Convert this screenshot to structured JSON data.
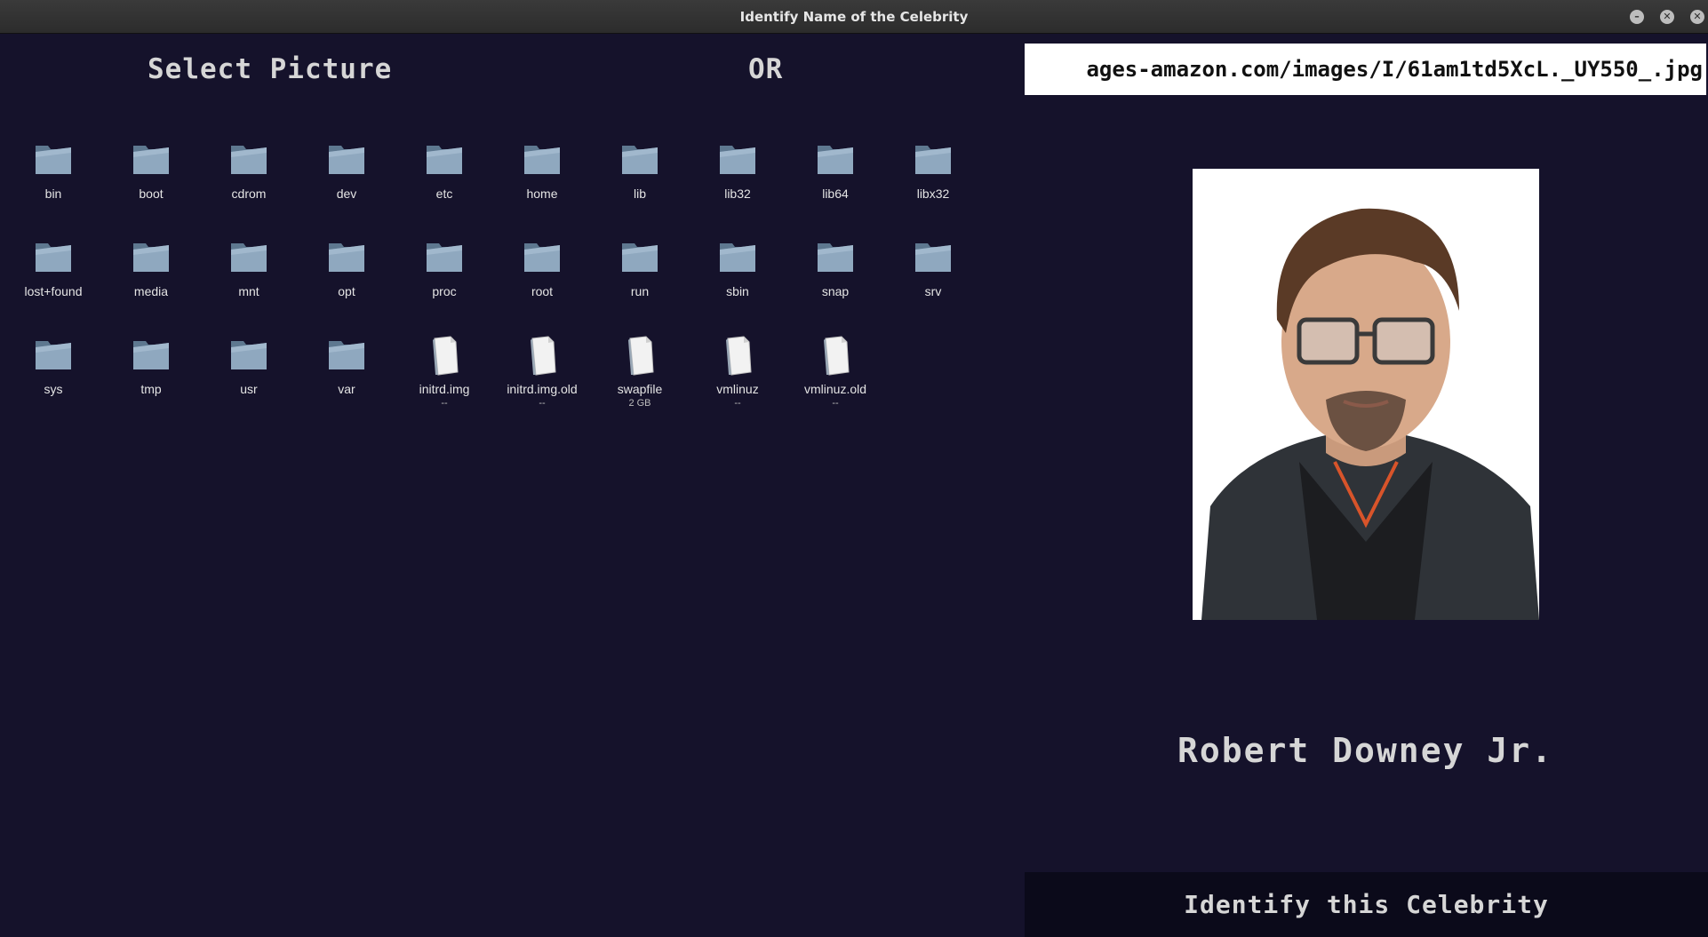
{
  "window": {
    "title": "Identify Name of the Celebrity",
    "buttons": {
      "minimize": "–",
      "maximize": "✕",
      "close": "✕"
    }
  },
  "left_panel": {
    "select_heading": "Select Picture",
    "or_label": "OR",
    "files": [
      {
        "name": "bin",
        "type": "folder"
      },
      {
        "name": "boot",
        "type": "folder"
      },
      {
        "name": "cdrom",
        "type": "folder"
      },
      {
        "name": "dev",
        "type": "folder"
      },
      {
        "name": "etc",
        "type": "folder"
      },
      {
        "name": "home",
        "type": "folder"
      },
      {
        "name": "lib",
        "type": "folder"
      },
      {
        "name": "lib32",
        "type": "folder"
      },
      {
        "name": "lib64",
        "type": "folder"
      },
      {
        "name": "libx32",
        "type": "folder"
      },
      {
        "name": "lost+found",
        "type": "folder"
      },
      {
        "name": "media",
        "type": "folder"
      },
      {
        "name": "mnt",
        "type": "folder"
      },
      {
        "name": "opt",
        "type": "folder"
      },
      {
        "name": "proc",
        "type": "folder"
      },
      {
        "name": "root",
        "type": "folder"
      },
      {
        "name": "run",
        "type": "folder"
      },
      {
        "name": "sbin",
        "type": "folder"
      },
      {
        "name": "snap",
        "type": "folder"
      },
      {
        "name": "srv",
        "type": "folder"
      },
      {
        "name": "sys",
        "type": "folder"
      },
      {
        "name": "tmp",
        "type": "folder"
      },
      {
        "name": "usr",
        "type": "folder"
      },
      {
        "name": "var",
        "type": "folder"
      },
      {
        "name": "initrd.img",
        "type": "file",
        "size": "--"
      },
      {
        "name": "initrd.img.old",
        "type": "file",
        "size": "--"
      },
      {
        "name": "swapfile",
        "type": "file",
        "size": "2 GB"
      },
      {
        "name": "vmlinuz",
        "type": "file",
        "size": "--"
      },
      {
        "name": "vmlinuz.old",
        "type": "file",
        "size": "--"
      }
    ]
  },
  "right_panel": {
    "url_value": "ages-amazon.com/images/I/61am1td5XcL._UY550_.jpg",
    "photo_icon": "celebrity-portrait",
    "celebrity_name": "Robert Downey Jr.",
    "identify_button": "Identify this Celebrity"
  },
  "colors": {
    "background": "#15122b",
    "titlebar": "#2c2c2c",
    "button_bg": "#0b0a1a",
    "text": "#d6d6d6",
    "folder": "#8fa8bf"
  }
}
